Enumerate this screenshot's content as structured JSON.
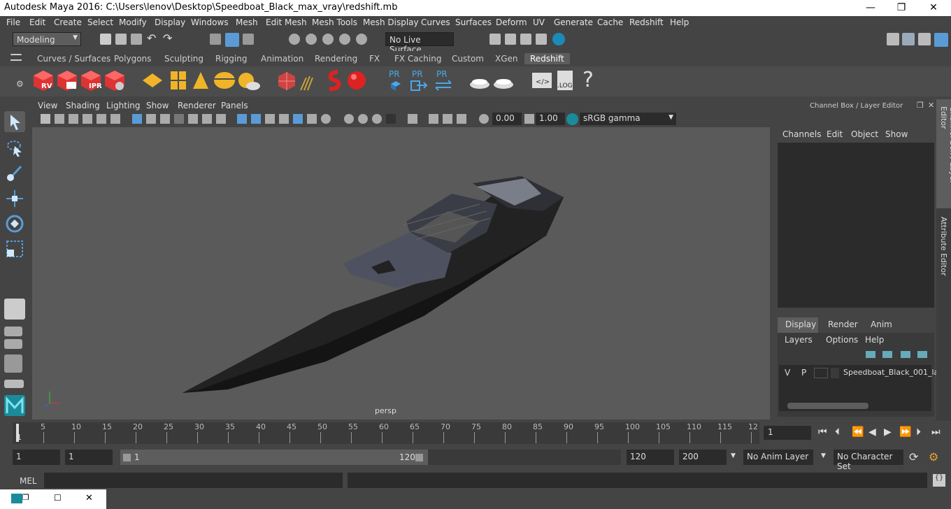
{
  "window": {
    "title": "Autodesk Maya 2016: C:\\Users\\lenov\\Desktop\\Speedboat_Black_max_vray\\redshift.mb",
    "minimize": "—",
    "maximize": "❐",
    "close": "✕"
  },
  "menus": [
    "File",
    "Edit",
    "Create",
    "Select",
    "Modify",
    "Display",
    "Windows",
    "Mesh",
    "Edit Mesh",
    "Mesh Tools",
    "Mesh Display",
    "Curves",
    "Surfaces",
    "Deform",
    "UV",
    "Generate",
    "Cache",
    "Redshift",
    "Help"
  ],
  "status": {
    "mode": "Modeling",
    "live_surface": "No Live Surface"
  },
  "shelf_tabs": [
    "Curves / Surfaces",
    "Polygons",
    "Sculpting",
    "Rigging",
    "Animation",
    "Rendering",
    "FX",
    "FX Caching",
    "Custom",
    "XGen",
    "Redshift"
  ],
  "shelf_active": "Redshift",
  "shelf_labels": {
    "rv": "RV",
    "ipr": "IPR",
    "pr1": "PR",
    "pr2": "PR",
    "pr3": "PR",
    "log": ".LOG",
    "help": "?"
  },
  "viewport": {
    "menus": [
      "View",
      "Shading",
      "Lighting",
      "Show",
      "Renderer",
      "Panels"
    ],
    "exposure": "0.00",
    "gamma": "1.00",
    "colorspace": "sRGB gamma",
    "camera": "persp"
  },
  "channel_box": {
    "title": "Channel Box / Layer Editor",
    "menus": [
      "Channels",
      "Edit",
      "Object",
      "Show"
    ]
  },
  "layer_editor": {
    "tabs": [
      "Display",
      "Render",
      "Anim"
    ],
    "active_tab": "Display",
    "menus": [
      "Layers",
      "Options",
      "Help"
    ],
    "layer": {
      "v": "V",
      "p": "P",
      "name": "Speedboat_Black_001_la"
    }
  },
  "side_tabs": {
    "channel": "Channel Box / Layer Editor",
    "attribute": "Attribute Editor"
  },
  "timeline": {
    "ticks": [
      "5",
      "10",
      "15",
      "20",
      "25",
      "30",
      "35",
      "40",
      "45",
      "50",
      "55",
      "60",
      "65",
      "70",
      "75",
      "80",
      "85",
      "90",
      "95",
      "100",
      "105",
      "110",
      "115",
      "12"
    ],
    "current": "1",
    "frame_field": "1"
  },
  "range": {
    "start": "1",
    "playstart": "1",
    "slider_start": "1",
    "slider_end": "120",
    "end": "120",
    "max": "200",
    "anim_layer": "No Anim Layer",
    "char_set": "No Character Set"
  },
  "mel": {
    "label": "MEL"
  },
  "accent": "#5a9bd5"
}
